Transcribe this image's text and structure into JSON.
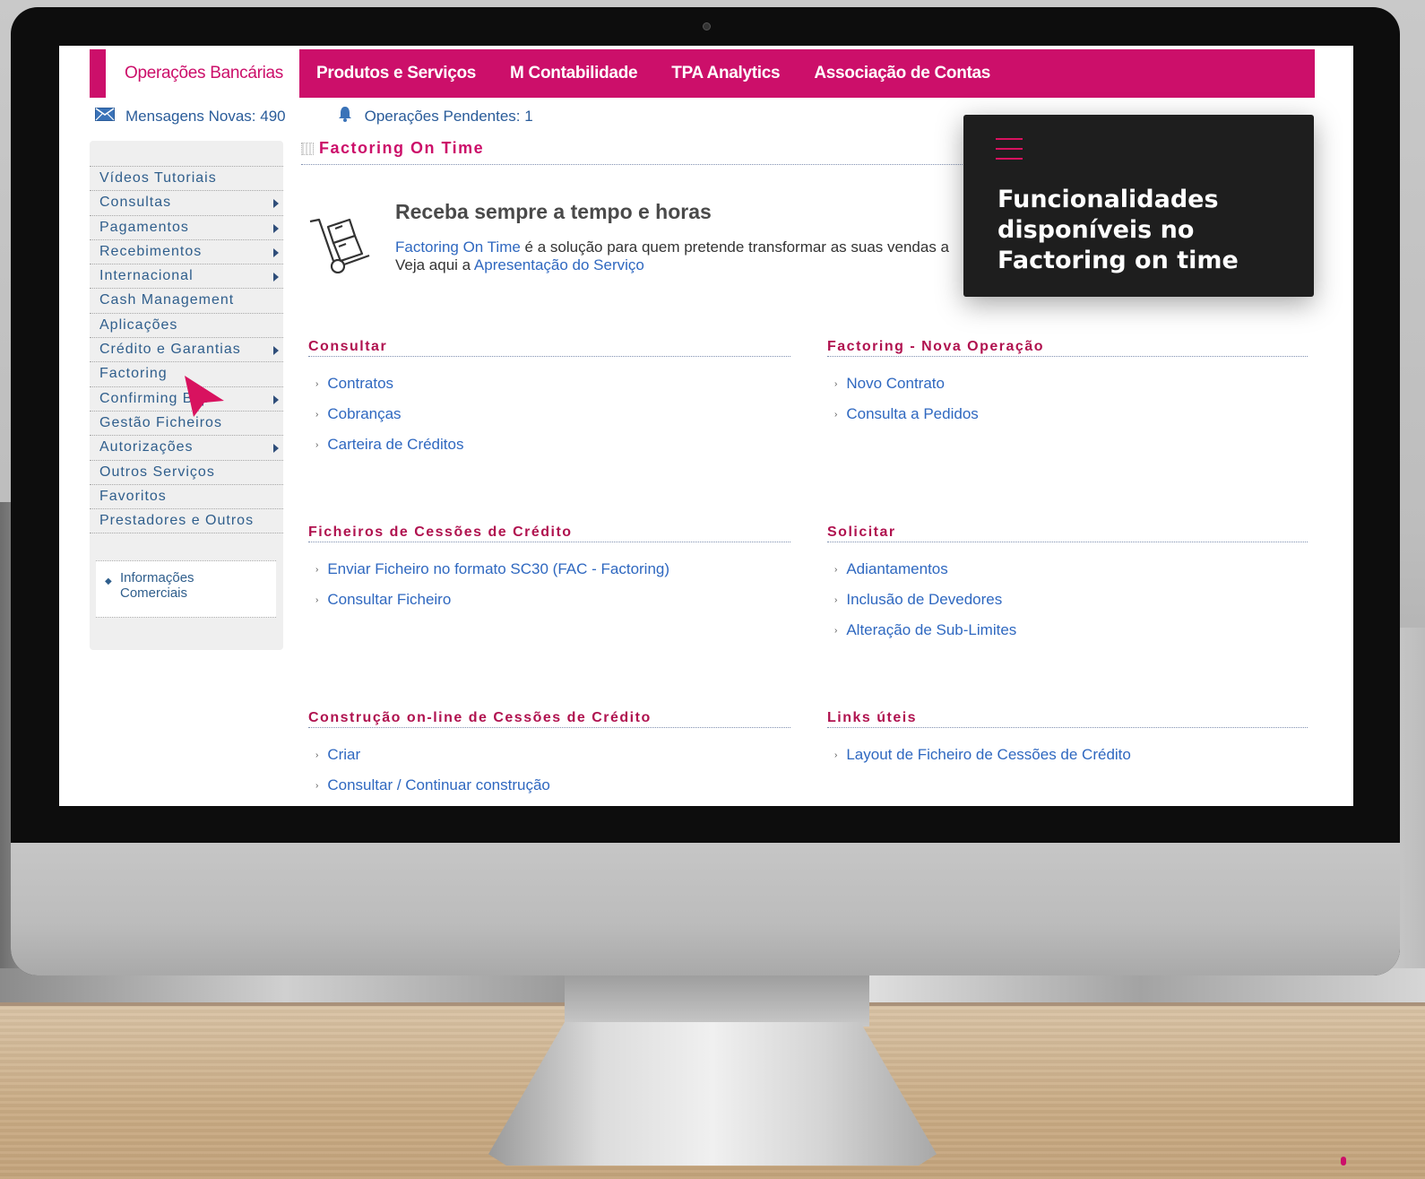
{
  "topnav": {
    "tabs": [
      {
        "label": "Operações Bancárias",
        "active": true
      },
      {
        "label": "Produtos e Serviços"
      },
      {
        "label": "M Contabilidade"
      },
      {
        "label": "TPA Analytics"
      },
      {
        "label": "Associação de Contas"
      }
    ]
  },
  "status": {
    "messages": "Mensagens Novas: 490",
    "pending": "Operações Pendentes: 1"
  },
  "sidebar": {
    "items": [
      {
        "label": "Vídeos Tutoriais",
        "submenu": false
      },
      {
        "label": "Consultas",
        "submenu": true
      },
      {
        "label": "Pagamentos",
        "submenu": true
      },
      {
        "label": "Recebimentos",
        "submenu": true
      },
      {
        "label": "Internacional",
        "submenu": true
      },
      {
        "label": "Cash Management",
        "submenu": false
      },
      {
        "label": "Aplicações",
        "submenu": false
      },
      {
        "label": "Crédito e Garantias",
        "submenu": true
      },
      {
        "label": "Factoring",
        "submenu": false
      },
      {
        "label": "Confirming Bcp",
        "submenu": true
      },
      {
        "label": "Gestão Ficheiros",
        "submenu": false
      },
      {
        "label": "Autorizações",
        "submenu": true
      },
      {
        "label": "Outros Serviços",
        "submenu": false
      },
      {
        "label": "Favoritos",
        "submenu": false
      },
      {
        "label": "Prestadores e Outros",
        "submenu": false
      }
    ],
    "info_line1": "Informações",
    "info_line2": "Comerciais"
  },
  "main": {
    "title": "Factoring On Time",
    "hero_title": "Receba sempre a tempo e horas",
    "hero_link": "Factoring On Time",
    "hero_text": " é a solução para quem pretende transformar as suas vendas a",
    "hero_line2_prefix": "Veja aqui a ",
    "hero_line2_link": "Apresentação do Serviço",
    "sections": {
      "consultar": {
        "title": "Consultar",
        "items": [
          "Contratos",
          "Cobranças",
          "Carteira de Créditos"
        ]
      },
      "nova_operacao": {
        "title": "Factoring - Nova Operação",
        "items": [
          "Novo Contrato",
          "Consulta a Pedidos"
        ]
      },
      "ficheiros": {
        "title": "Ficheiros de Cessões de Crédito",
        "items": [
          "Enviar Ficheiro no formato SC30 (FAC - Factoring)",
          "Consultar Ficheiro"
        ]
      },
      "solicitar": {
        "title": "Solicitar",
        "items": [
          "Adiantamentos",
          "Inclusão de Devedores",
          "Alteração de Sub-Limites"
        ]
      },
      "construcao": {
        "title": "Construção on-line de Cessões de Crédito",
        "items": [
          "Criar",
          "Consultar / Continuar construção"
        ]
      },
      "links": {
        "title": "Links úteis",
        "items": [
          "Layout de Ficheiro de Cessões de Crédito"
        ]
      }
    }
  },
  "overlay": {
    "line1": "Funcionalidades",
    "line2": "disponíveis no",
    "line3": "Factoring on time"
  },
  "colors": {
    "brand": "#cc0f6a",
    "link": "#2f68c0",
    "section_title": "#b0124f"
  },
  "icons": [
    "mail-icon",
    "bell-icon",
    "hand-truck-icon",
    "menu-icon",
    "cursor-arrow-icon"
  ]
}
